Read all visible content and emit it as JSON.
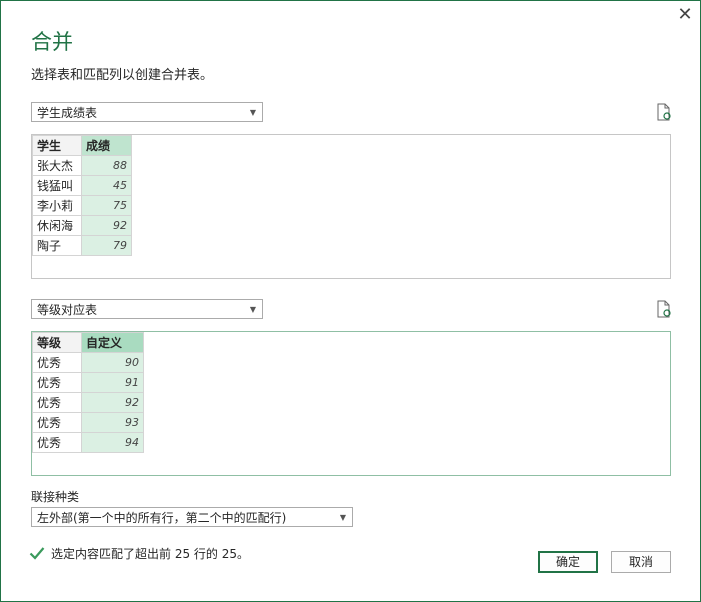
{
  "dialog": {
    "title": "合并",
    "subtitle": "选择表和匹配列以创建合并表。",
    "close_glyph": "✕"
  },
  "table1": {
    "selected": "学生成绩表",
    "columns": [
      "学生",
      "成绩"
    ],
    "rows": [
      [
        "张大杰",
        "88"
      ],
      [
        "钱猛叫",
        "45"
      ],
      [
        "李小莉",
        "75"
      ],
      [
        "休闲海",
        "92"
      ],
      [
        "陶子",
        "79"
      ]
    ]
  },
  "table2": {
    "selected": "等级对应表",
    "columns": [
      "等级",
      "自定义"
    ],
    "rows": [
      [
        "优秀",
        "90"
      ],
      [
        "优秀",
        "91"
      ],
      [
        "优秀",
        "92"
      ],
      [
        "优秀",
        "93"
      ],
      [
        "优秀",
        "94"
      ]
    ]
  },
  "join": {
    "label": "联接种类",
    "selected": "左外部(第一个中的所有行，第二个中的匹配行)"
  },
  "status": {
    "text": "选定内容匹配了超出前 25 行的 25。"
  },
  "buttons": {
    "ok": "确定",
    "cancel": "取消"
  },
  "colors": {
    "accent": "#217346",
    "selected_column": "#dbf0e3"
  },
  "icons": [
    "close-icon",
    "refresh-icon",
    "dropdown-arrow-icon",
    "check-icon"
  ]
}
